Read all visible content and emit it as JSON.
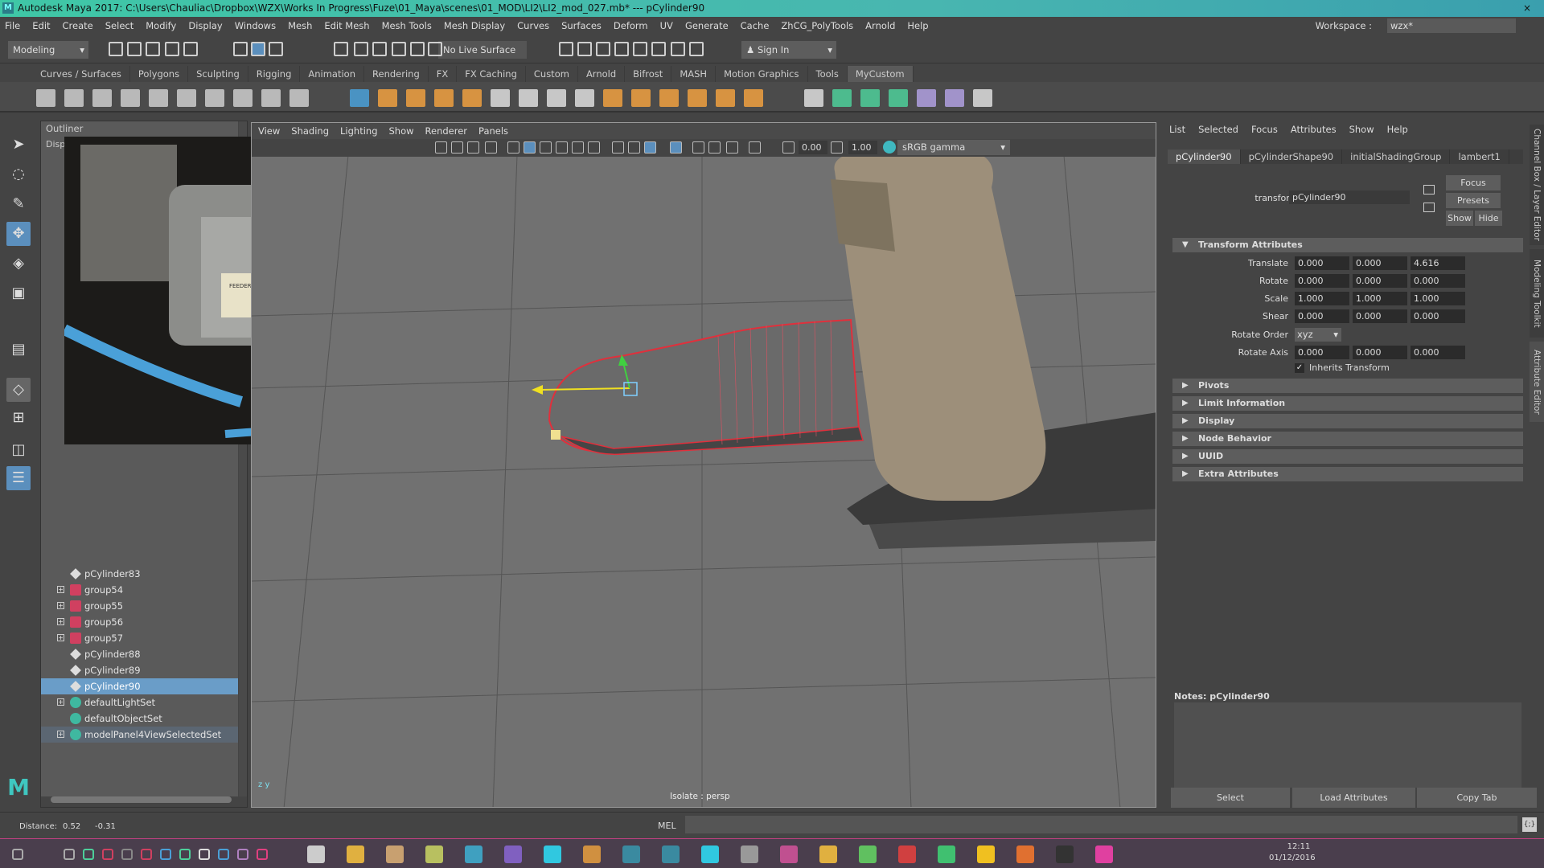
{
  "window": {
    "title": "Autodesk Maya 2017: C:\\Users\\Chauliac\\Dropbox\\WZX\\Works In Progress\\Fuze\\01_Maya\\scenes\\01_MOD\\LI2\\LI2_mod_027.mb*   ---   pCylinder90"
  },
  "menu": [
    "File",
    "Edit",
    "Create",
    "Select",
    "Modify",
    "Display",
    "Windows",
    "Mesh",
    "Edit Mesh",
    "Mesh Tools",
    "Mesh Display",
    "Curves",
    "Surfaces",
    "Deform",
    "UV",
    "Generate",
    "Cache",
    "ZhCG_PolyTools",
    "Arnold",
    "Help"
  ],
  "workspace": {
    "label": "Workspace :",
    "value": "wzx*"
  },
  "status": {
    "mode": "Modeling",
    "live_surface": "No Live Surface",
    "sign_in": "Sign In"
  },
  "shelf_tabs": [
    "Curves / Surfaces",
    "Polygons",
    "Sculpting",
    "Rigging",
    "Animation",
    "Rendering",
    "FX",
    "FX Caching",
    "Custom",
    "Arnold",
    "Bifrost",
    "MASH",
    "Motion Graphics",
    "Tools",
    "MyCustom"
  ],
  "shelf_active": "MyCustom",
  "outliner": {
    "title": "Outliner",
    "sub": "Disp",
    "items": [
      {
        "label": "pCylinder83",
        "type": "mesh",
        "expand": false
      },
      {
        "label": "group54",
        "type": "group",
        "expand": true
      },
      {
        "label": "group55",
        "type": "group",
        "expand": true
      },
      {
        "label": "group56",
        "type": "group",
        "expand": true
      },
      {
        "label": "group57",
        "type": "group",
        "expand": true
      },
      {
        "label": "pCylinder88",
        "type": "mesh",
        "expand": false
      },
      {
        "label": "pCylinder89",
        "type": "mesh",
        "expand": false
      },
      {
        "label": "pCylinder90",
        "type": "mesh",
        "expand": false,
        "selected": true
      },
      {
        "label": "defaultLightSet",
        "type": "set",
        "expand": true
      },
      {
        "label": "defaultObjectSet",
        "type": "set",
        "expand": false
      },
      {
        "label": "modelPanel4ViewSelectedSet",
        "type": "set",
        "expand": true,
        "highlight": true
      }
    ]
  },
  "viewport": {
    "menu": [
      "View",
      "Shading",
      "Lighting",
      "Show",
      "Renderer",
      "Panels"
    ],
    "exposure": "0.00",
    "gamma": "1.00",
    "color_space": "sRGB gamma",
    "hud": "Isolate : persp",
    "axis_z": "z",
    "axis_y": "y"
  },
  "reference_image": {
    "label_lines": [
      "FEEDER DEJINKER"
    ]
  },
  "attr_editor": {
    "menu": [
      "List",
      "Selected",
      "Focus",
      "Attributes",
      "Show",
      "Help"
    ],
    "tabs": [
      "pCylinder90",
      "pCylinderShape90",
      "initialShadingGroup",
      "lambert1"
    ],
    "transform_label": "transform:",
    "transform_value": "pCylinder90",
    "buttons": {
      "focus": "Focus",
      "presets": "Presets",
      "show": "Show",
      "hide": "Hide"
    },
    "section_open": "Transform Attributes",
    "attrs": [
      {
        "label": "Translate",
        "values": [
          "0.000",
          "0.000",
          "4.616"
        ]
      },
      {
        "label": "Rotate",
        "values": [
          "0.000",
          "0.000",
          "0.000"
        ]
      },
      {
        "label": "Scale",
        "values": [
          "1.000",
          "1.000",
          "1.000"
        ]
      },
      {
        "label": "Shear",
        "values": [
          "0.000",
          "0.000",
          "0.000"
        ]
      }
    ],
    "rotate_order_label": "Rotate Order",
    "rotate_order": "xyz",
    "rotate_axis": {
      "label": "Rotate Axis",
      "values": [
        "0.000",
        "0.000",
        "0.000"
      ]
    },
    "inherits": {
      "label": "Inherits Transform",
      "checked": true
    },
    "sections": [
      "Pivots",
      "Limit Information",
      "Display",
      "Node Behavior",
      "UUID",
      "Extra Attributes"
    ],
    "notes": "Notes:  pCylinder90",
    "bottom": [
      "Select",
      "Load Attributes",
      "Copy Tab"
    ]
  },
  "side_tabs": [
    "Channel Box / Layer Editor",
    "Modeling Toolkit",
    "Attribute Editor"
  ],
  "helpline": {
    "distance_label": "Distance:",
    "d1": "0.52",
    "d2": "-0.31",
    "mel": "MEL"
  },
  "taskbar": {
    "time": "12:11",
    "date": "01/12/2016"
  },
  "colors": {
    "selection": "#6a9dc8",
    "mesh_outline": "#e0303c",
    "object": "#9e907c",
    "title": "#3fc7a6"
  }
}
